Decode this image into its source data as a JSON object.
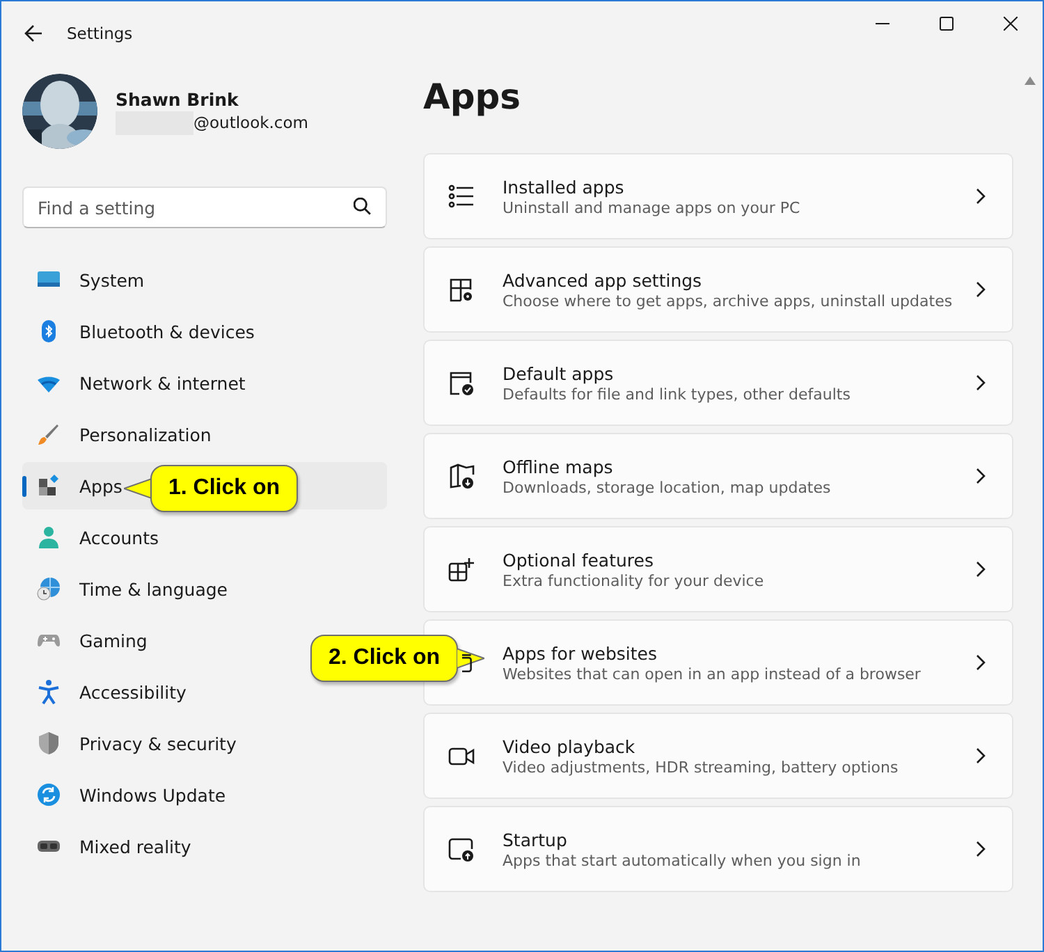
{
  "window": {
    "title": "Settings"
  },
  "profile": {
    "name": "Shawn Brink",
    "email": "@outlook.com",
    "email_redacted": true
  },
  "search": {
    "placeholder": "Find a setting"
  },
  "nav": [
    {
      "label": "System",
      "selected": false
    },
    {
      "label": "Bluetooth & devices",
      "selected": false
    },
    {
      "label": "Network & internet",
      "selected": false
    },
    {
      "label": "Personalization",
      "selected": false
    },
    {
      "label": "Apps",
      "selected": true
    },
    {
      "label": "Accounts",
      "selected": false
    },
    {
      "label": "Time & language",
      "selected": false
    },
    {
      "label": "Gaming",
      "selected": false
    },
    {
      "label": "Accessibility",
      "selected": false
    },
    {
      "label": "Privacy & security",
      "selected": false
    },
    {
      "label": "Windows Update",
      "selected": false
    },
    {
      "label": "Mixed reality",
      "selected": false
    }
  ],
  "page_title": "Apps",
  "cards": [
    {
      "title": "Installed apps",
      "description": "Uninstall and manage apps on your PC"
    },
    {
      "title": "Advanced app settings",
      "description": "Choose where to get apps, archive apps, uninstall updates"
    },
    {
      "title": "Default apps",
      "description": "Defaults for file and link types, other defaults"
    },
    {
      "title": "Offline maps",
      "description": "Downloads, storage location, map updates"
    },
    {
      "title": "Optional features",
      "description": "Extra functionality for your device"
    },
    {
      "title": "Apps for websites",
      "description": "Websites that can open in an app instead of a browser"
    },
    {
      "title": "Video playback",
      "description": "Video adjustments, HDR streaming, battery options"
    },
    {
      "title": "Startup",
      "description": "Apps that start automatically when you sign in"
    }
  ],
  "callouts": [
    {
      "text": "1. Click on",
      "kind": "left"
    },
    {
      "text": "2. Click on",
      "kind": "right"
    }
  ]
}
